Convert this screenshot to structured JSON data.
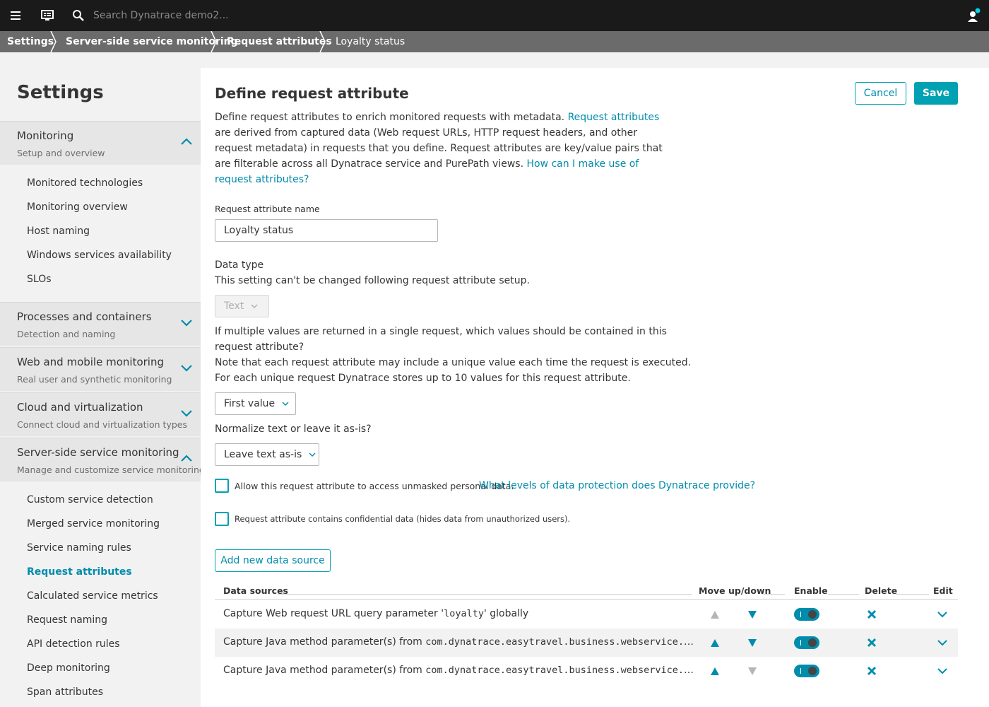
{
  "topbar": {
    "search_placeholder": "Search Dynatrace demo2..."
  },
  "breadcrumb": [
    "Settings",
    "Server-side service monitoring",
    "Request attributes",
    "Loyalty status"
  ],
  "sidebar": {
    "title": "Settings",
    "groups": [
      {
        "title": "Monitoring",
        "subtitle": "Setup and overview",
        "expanded": true,
        "items": [
          "Monitored technologies",
          "Monitoring overview",
          "Host naming",
          "Windows services availability",
          "SLOs"
        ]
      },
      {
        "title": "Processes and containers",
        "subtitle": "Detection and naming",
        "expanded": false
      },
      {
        "title": "Web and mobile monitoring",
        "subtitle": "Real user and synthetic monitoring",
        "expanded": false
      },
      {
        "title": "Cloud and virtualization",
        "subtitle": "Connect cloud and virtualization types",
        "expanded": false
      },
      {
        "title": "Server-side service monitoring",
        "subtitle": "Manage and customize service monitoring",
        "expanded": true,
        "items": [
          "Custom service detection",
          "Merged service monitoring",
          "Service naming rules",
          "Request attributes",
          "Calculated service metrics",
          "Request naming",
          "API detection rules",
          "Deep monitoring",
          "Span attributes"
        ],
        "active_item": "Request attributes"
      }
    ]
  },
  "main": {
    "title": "Define request attribute",
    "cancel_label": "Cancel",
    "save_label": "Save",
    "intro": {
      "line1_text": "Define request attributes to enrich monitored requests with metadata.",
      "line1_link": "Request attributes",
      "line2": "are derived from captured data (Web request URLs, HTTP request headers, and other",
      "line3": "request metadata) in requests that you define. Request attributes are key/value pairs that",
      "line4_text": "are filterable across all Dynatrace service and PurePath views.",
      "line4_link": "How can I make use of",
      "line5_link": "request attributes?"
    },
    "name_label": "Request attribute name",
    "name_value": "Loyalty status",
    "data_type_label": "Data type",
    "data_type_note": "This setting can't be changed following request attribute setup.",
    "data_type_value": "Text",
    "multi_q1": "If multiple values are returned in a single request, which values should be contained in this",
    "multi_q2": "request attribute?",
    "multi_note1": "Note that each request attribute may include a unique value each time the request is executed.",
    "multi_note2": "For each unique request Dynatrace stores up to 10 values for this request attribute.",
    "multi_value": "First value",
    "normalize_label": "Normalize text or leave it as-is?",
    "normalize_value": "Leave text as-is",
    "cb_personal_label": "Allow this request attribute to access unmasked personal data.",
    "cb_personal_link": "What levels of data protection does Dynatrace provide?",
    "cb_personal_checked": false,
    "cb_confidential_label": "Request attribute contains confidential data (hides data from unauthorized users).",
    "cb_confidential_checked": false,
    "add_source_label": "Add new data source",
    "table": {
      "headers": {
        "sources": "Data sources",
        "move": "Move up/down",
        "enable": "Enable",
        "delete": "Delete",
        "edit": "Edit"
      },
      "rows": [
        {
          "prefix": "Capture Web request URL query parameter '",
          "code": "loyalty",
          "suffix": "' globally",
          "up_enabled": false,
          "down_enabled": true,
          "enabled": true
        },
        {
          "prefix": "Capture Java method parameter(s) from ",
          "code": "com.dynatrace.easytravel.business.webservice.Boo…",
          "suffix": "",
          "up_enabled": true,
          "down_enabled": true,
          "enabled": true
        },
        {
          "prefix": "Capture Java method parameter(s) from ",
          "code": "com.dynatrace.easytravel.business.webservice.Aut…",
          "suffix": "",
          "up_enabled": true,
          "down_enabled": false,
          "enabled": true
        }
      ]
    }
  },
  "colors": {
    "accent": "#00a1b2",
    "link": "#008cab",
    "topbar": "#1a1a1a",
    "breadcrumb": "#6b6b6b",
    "notification_dot": "#00d4e6"
  }
}
